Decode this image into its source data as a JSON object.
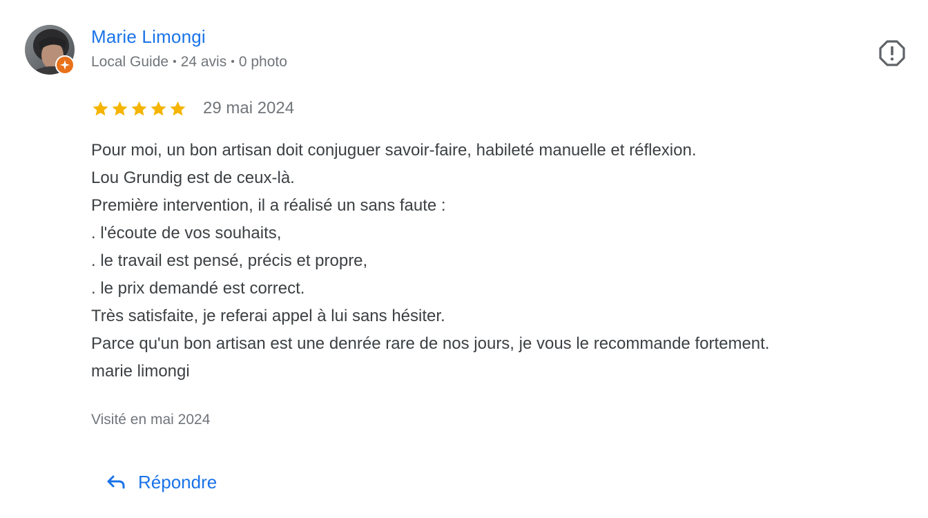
{
  "author": {
    "name": "Marie Limongi",
    "badge": "Local Guide",
    "reviews_count": "24 avis",
    "photos_count": "0 photo",
    "separator": "•",
    "avatar_icon": "person-photo-avatar",
    "badge_icon": "local-guide-star-icon"
  },
  "review": {
    "rating": 5,
    "max_rating": 5,
    "date": "29 mai 2024",
    "text_lines": [
      "Pour moi, un bon artisan doit conjuguer savoir-faire, habileté manuelle et réflexion.",
      "Lou Grundig est de ceux-là.",
      "Première intervention, il a réalisé un sans faute :",
      ". l'écoute de vos souhaits,",
      ". le travail est pensé, précis et propre,",
      ". le prix demandé est correct.",
      "Très satisfaite, je referai appel à lui sans hésiter.",
      "Parce qu'un bon artisan est une denrée rare de nos jours, je vous le recommande fortement.",
      "marie limongi"
    ],
    "visit": "Visité en mai 2024"
  },
  "actions": {
    "reply_label": "Répondre",
    "reply_icon": "reply-arrow-icon",
    "report_icon": "report-octagon-icon"
  },
  "colors": {
    "link_blue": "#1a73e8",
    "text": "#3c4043",
    "secondary_text": "#70757a",
    "star_gold": "#f4b400",
    "guide_orange": "#e8711a"
  }
}
